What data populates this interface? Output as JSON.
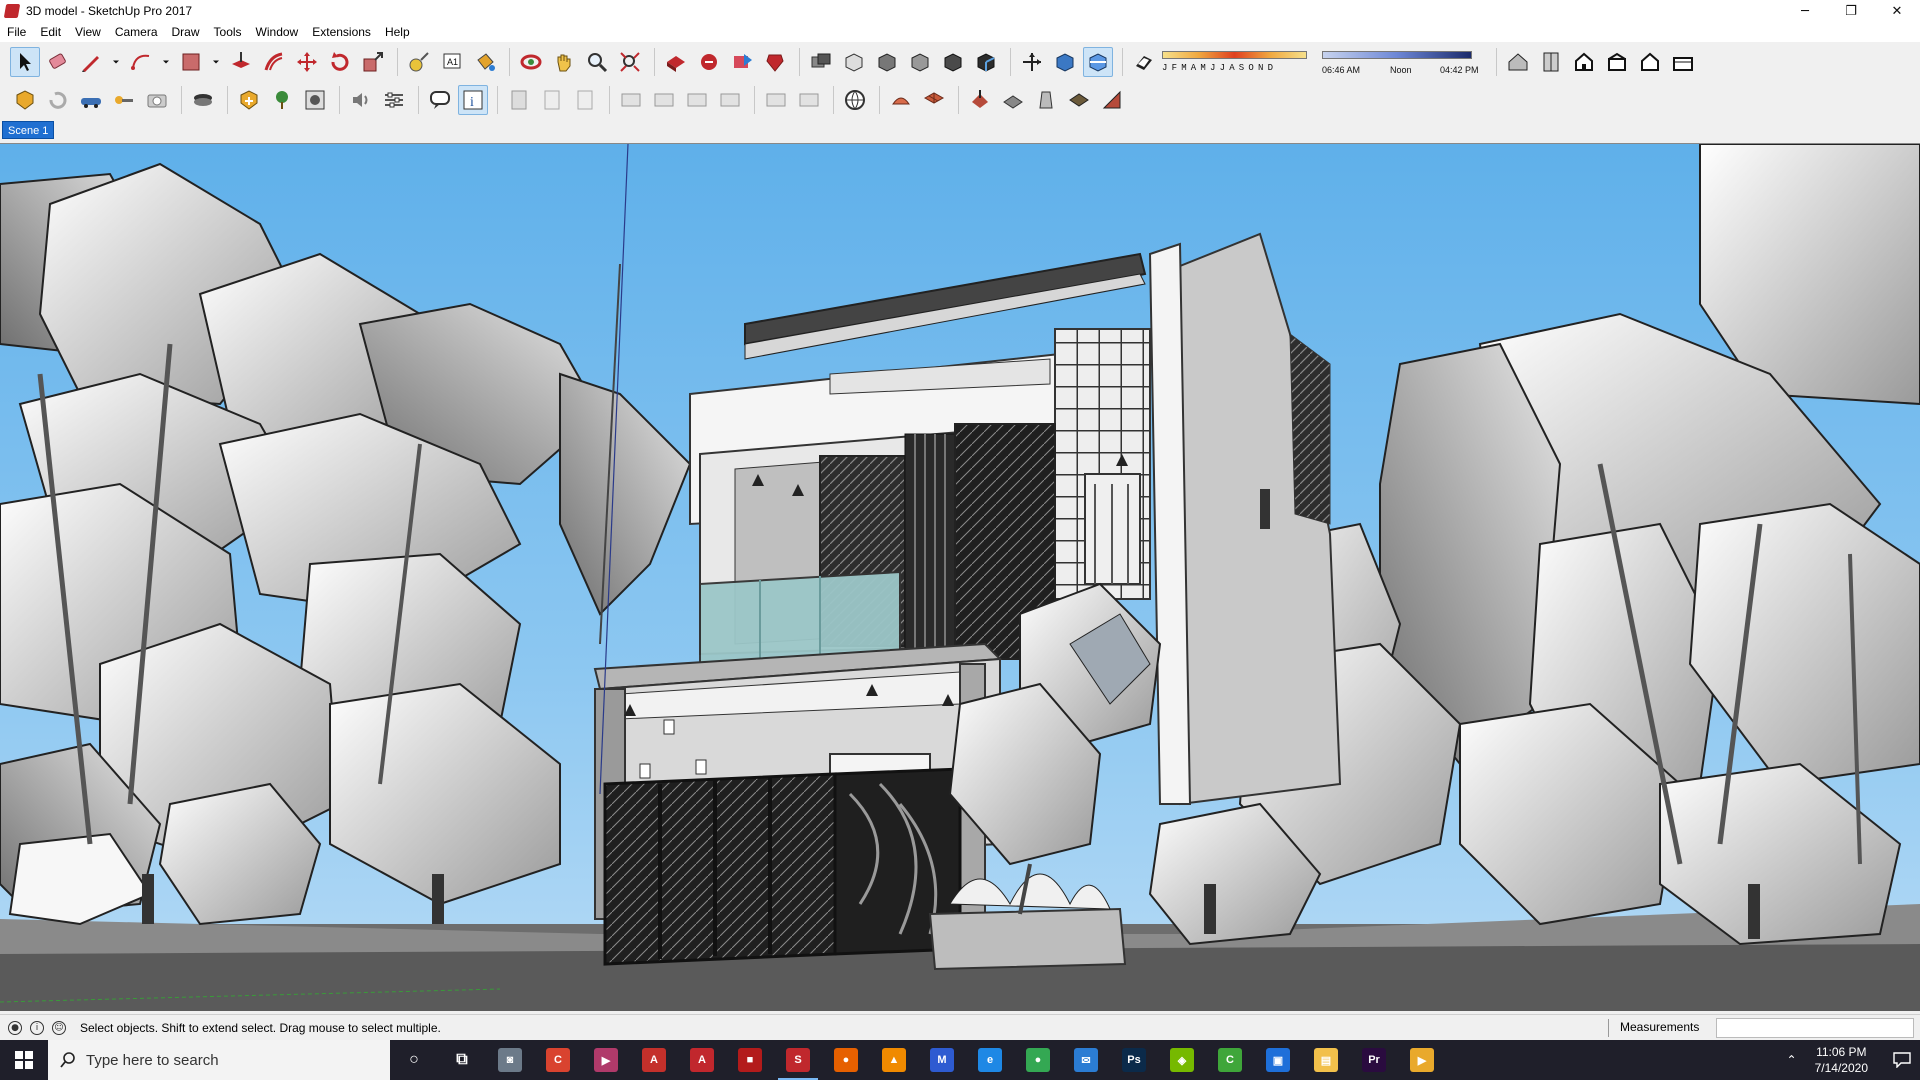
{
  "window": {
    "title": "3D model - SketchUp Pro 2017",
    "controls": {
      "minimize": "─",
      "restore": "❐",
      "close": "✕"
    }
  },
  "menu": [
    "File",
    "Edit",
    "View",
    "Camera",
    "Draw",
    "Tools",
    "Window",
    "Extensions",
    "Help"
  ],
  "shadow_settings": {
    "months": "JFMAMJJASOND",
    "time_start": "06:46 AM",
    "time_mid": "Noon",
    "time_end": "04:42 PM"
  },
  "scene": {
    "active_tab": "Scene 1"
  },
  "status": {
    "message": "Select objects. Shift to extend select. Drag mouse to select multiple.",
    "measurements_label": "Measurements",
    "measurements_value": ""
  },
  "taskbar": {
    "search_placeholder": "Type here to search",
    "time": "11:06 PM",
    "date": "7/14/2020",
    "apps": [
      {
        "name": "cortana",
        "color": "#ffffff",
        "glyph": "○"
      },
      {
        "name": "task-view",
        "color": "#ffffff",
        "glyph": "⧉"
      },
      {
        "name": "camera",
        "color": "#6c7a89",
        "glyph": "◙"
      },
      {
        "name": "app-c",
        "color": "#d9432f",
        "glyph": "C"
      },
      {
        "name": "video-editor",
        "color": "#b03a6a",
        "glyph": "▶"
      },
      {
        "name": "acrobat",
        "color": "#c4302b",
        "glyph": "A"
      },
      {
        "name": "autocad",
        "color": "#c1272d",
        "glyph": "A"
      },
      {
        "name": "red-app",
        "color": "#b31b1b",
        "glyph": "■"
      },
      {
        "name": "sketchup",
        "color": "#c0282d",
        "glyph": "S"
      },
      {
        "name": "firefox",
        "color": "#e66000",
        "glyph": "●"
      },
      {
        "name": "vlc",
        "color": "#f08a00",
        "glyph": "▲"
      },
      {
        "name": "malwarebytes",
        "color": "#2e5bd1",
        "glyph": "M"
      },
      {
        "name": "edge",
        "color": "#1e88e5",
        "glyph": "e"
      },
      {
        "name": "chrome",
        "color": "#34a853",
        "glyph": "●"
      },
      {
        "name": "mail",
        "color": "#2b7cd3",
        "glyph": "✉"
      },
      {
        "name": "photoshop",
        "color": "#0b2a4a",
        "glyph": "Ps"
      },
      {
        "name": "nvidia",
        "color": "#76b900",
        "glyph": "◈"
      },
      {
        "name": "camtasia",
        "color": "#3fa63a",
        "glyph": "C"
      },
      {
        "name": "store",
        "color": "#1e6fd9",
        "glyph": "▣"
      },
      {
        "name": "file-explorer",
        "color": "#f2c04b",
        "glyph": "▤"
      },
      {
        "name": "premiere",
        "color": "#2a0b3f",
        "glyph": "Pr"
      },
      {
        "name": "media-player",
        "color": "#e9a92c",
        "glyph": "▶"
      }
    ],
    "active_app": "sketchup"
  },
  "colors": {
    "selection_blue": "#1f6fd1",
    "sky": "#5fb0ea",
    "brand_red": "#c0282d"
  }
}
